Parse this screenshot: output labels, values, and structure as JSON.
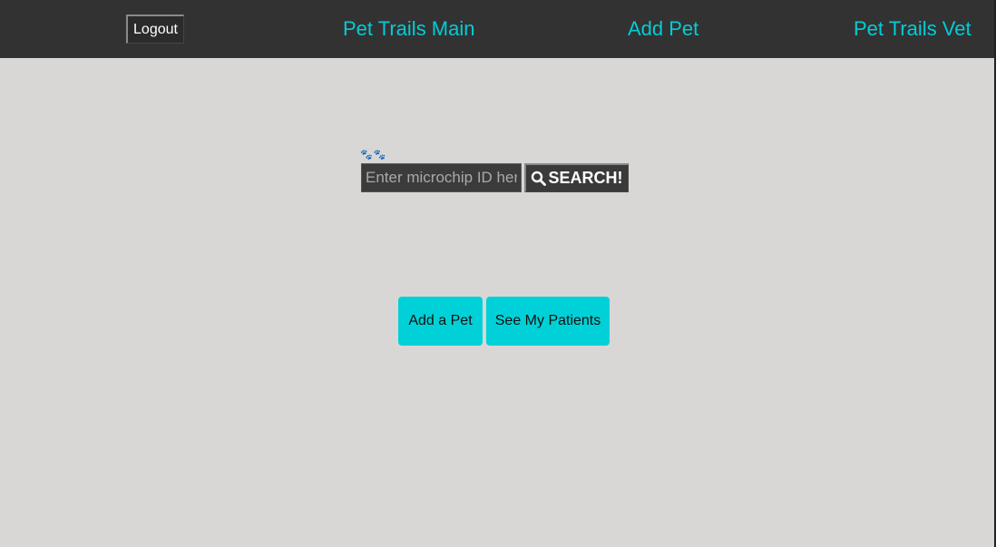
{
  "navbar": {
    "logout_label": "Logout",
    "links": [
      {
        "label": "Pet Trails Main"
      },
      {
        "label": "Add Pet"
      },
      {
        "label": "Pet Trails Vet"
      }
    ]
  },
  "search": {
    "paw_glyphs": "🐾🐾",
    "placeholder": "Enter microchip ID here.",
    "value": "",
    "button_label": "SEARCH!"
  },
  "actions": {
    "add_pet_label": "Add a Pet",
    "see_patients_label": "See My Patients"
  },
  "colors": {
    "navbar_bg": "#333232",
    "page_bg": "#d8d7d5",
    "accent": "#00cdd6",
    "button_bg": "#00d1d8"
  }
}
